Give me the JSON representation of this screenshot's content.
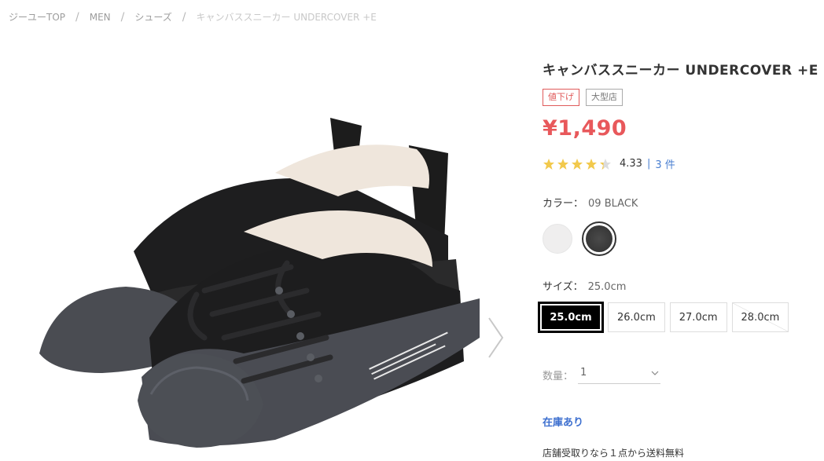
{
  "breadcrumb": [
    {
      "label": "ジーユーTOP"
    },
    {
      "label": "MEN"
    },
    {
      "label": "シューズ"
    },
    {
      "label": "キャンバススニーカー UNDERCOVER +E"
    }
  ],
  "product": {
    "title": "キャンバススニーカー UNDERCOVER +E",
    "tags": [
      "値下げ",
      "大型店"
    ],
    "price": "¥1,490",
    "rating": {
      "score": "4.33",
      "stars": 4.33,
      "count": "3 件"
    },
    "color": {
      "label": "カラー：",
      "value": "09 BLACK",
      "swatches": [
        {
          "name": "white",
          "hex": "#efeeee"
        },
        {
          "name": "black",
          "hex": "#3a3a3a"
        }
      ]
    },
    "size": {
      "label": "サイズ：",
      "value": "25.0cm",
      "options": [
        "25.0cm",
        "26.0cm",
        "27.0cm",
        "28.0cm"
      ]
    },
    "quantity": {
      "label": "数量：",
      "value": "1"
    },
    "stock": "在庫あり",
    "pickup": "店舗受取りなら１点から送料無料"
  },
  "colors": {
    "price": "#e8585b",
    "link": "#4a7fd1",
    "star": "#f2c94c"
  },
  "icons": {
    "next": "chevron-right-icon",
    "dropdown": "chevron-down-icon"
  }
}
